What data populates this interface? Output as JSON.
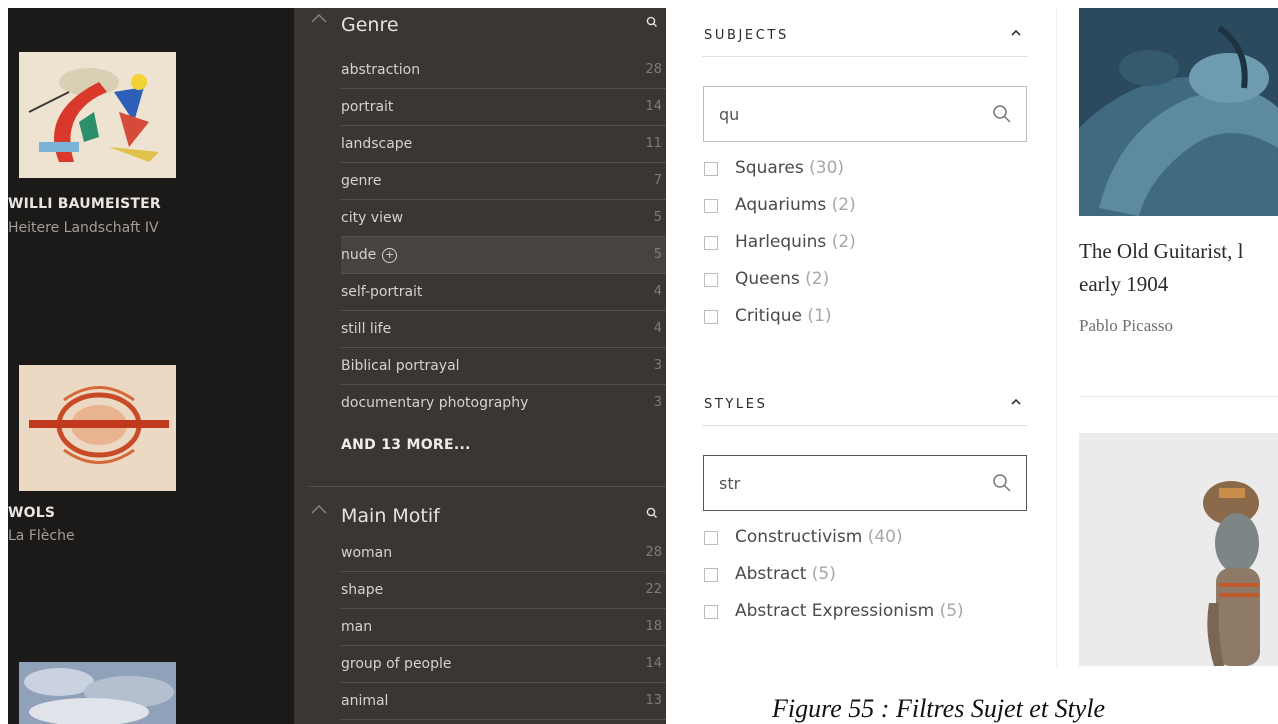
{
  "gallery": [
    {
      "artist": "WILLI BAUMEISTER",
      "title": "Heitere Landschaft IV"
    },
    {
      "artist": "WOLS",
      "title": "La Flèche"
    },
    {
      "artist": "",
      "title": ""
    }
  ],
  "facets": {
    "genre": {
      "title": "Genre",
      "items": [
        {
          "label": "abstraction",
          "count": "28"
        },
        {
          "label": "portrait",
          "count": "14"
        },
        {
          "label": "landscape",
          "count": "11"
        },
        {
          "label": "genre",
          "count": "7"
        },
        {
          "label": "city view",
          "count": "5"
        },
        {
          "label": "nude",
          "count": "5"
        },
        {
          "label": "self-portrait",
          "count": "4"
        },
        {
          "label": "still life",
          "count": "4"
        },
        {
          "label": "Biblical portrayal",
          "count": "3"
        },
        {
          "label": "documentary photography",
          "count": "3"
        }
      ],
      "more": "AND 13 MORE..."
    },
    "main_motif": {
      "title": "Main Motif",
      "items": [
        {
          "label": "woman",
          "count": "28"
        },
        {
          "label": "shape",
          "count": "22"
        },
        {
          "label": "man",
          "count": "18"
        },
        {
          "label": "group of people",
          "count": "14"
        },
        {
          "label": "animal",
          "count": "13"
        }
      ]
    },
    "plus_symbol": "+"
  },
  "filters": {
    "subjects": {
      "title": "SUBJECTS",
      "search_value": "qu",
      "options": [
        {
          "label": "Squares",
          "count": "(30)"
        },
        {
          "label": "Aquariums",
          "count": "(2)"
        },
        {
          "label": "Harlequins",
          "count": "(2)"
        },
        {
          "label": "Queens",
          "count": "(2)"
        },
        {
          "label": "Critique",
          "count": "(1)"
        }
      ]
    },
    "styles": {
      "title": "STYLES",
      "search_value": "str",
      "options": [
        {
          "label": "Constructivism",
          "count": "(40)"
        },
        {
          "label": "Abstract",
          "count": "(5)"
        },
        {
          "label": "Abstract Expressionism",
          "count": "(5)"
        }
      ]
    }
  },
  "results": [
    {
      "title_line1": "The Old Guitarist, l",
      "title_line2": "early 1904",
      "artist": "Pablo Picasso"
    }
  ],
  "caption": "Figure 55 : Filtres Sujet et Style",
  "icons": [
    "chevron-up-icon",
    "search-icon",
    "plus-circle-icon",
    "checkbox-icon"
  ],
  "colors": {
    "dark_panel": "#1c1a19",
    "facet_panel": "#393634",
    "highlight_row": "#474341"
  }
}
